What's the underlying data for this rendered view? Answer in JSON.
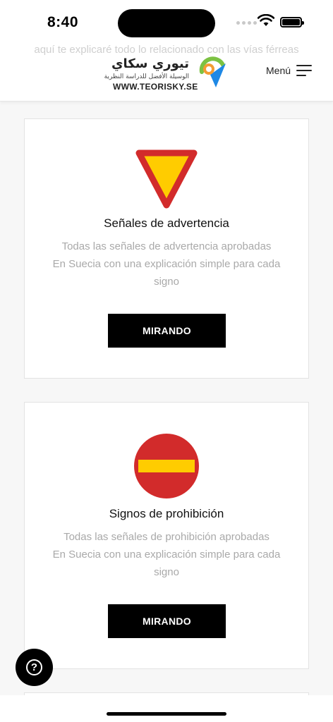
{
  "status": {
    "time": "8:40"
  },
  "header": {
    "ghost_text": "aquí te explicaré todo lo relacionado con las vías férreas",
    "logo": {
      "arabic_name": "تيوري سكاي",
      "arabic_tagline": "الوسيلة الأفضل للدراسة النظرية",
      "url": "WWW.TEORISKY.SE"
    },
    "menu_label": "Menú"
  },
  "cards": [
    {
      "title": "Señales de advertencia",
      "desc_line1": "Todas las señales de advertencia aprobadas",
      "desc_line2": "En Suecia con una explicación simple para cada signo",
      "button": "MIRANDO",
      "icon": "yield-triangle-icon"
    },
    {
      "title": "Signos de prohibición",
      "desc_line1": "Todas las señales de prohibición aprobadas",
      "desc_line2": "En Suecia con una explicación simple para cada signo",
      "button": "MIRANDO",
      "icon": "no-entry-icon"
    }
  ],
  "help": {
    "glyph": "?"
  },
  "colors": {
    "warning_red": "#d22b2b",
    "warning_yellow": "#ffcc00",
    "button_black": "#000000",
    "logo_green": "#7cc242",
    "logo_blue": "#1e88e5",
    "logo_orange": "#f39c33"
  }
}
